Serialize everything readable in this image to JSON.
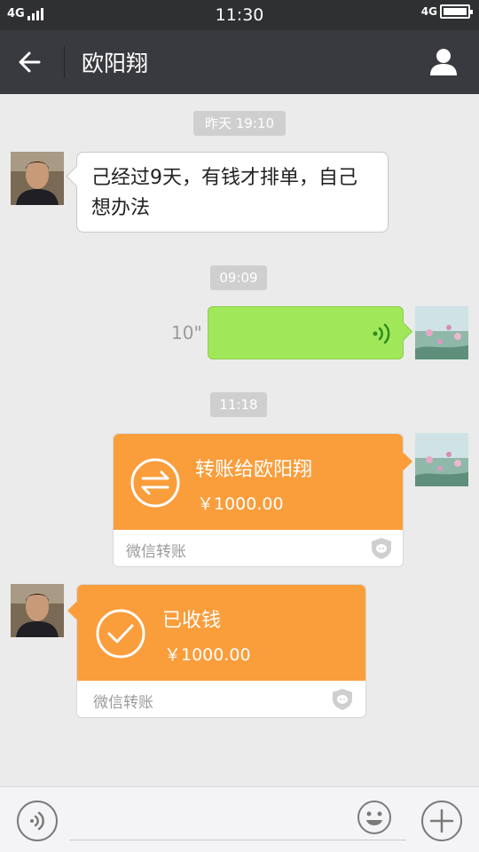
{
  "status_bar": {
    "network_left": "4G",
    "time": "11:30",
    "network_right": "4G"
  },
  "nav": {
    "title": "欧阳翔",
    "back_icon": "arrow-left-icon",
    "profile_icon": "person-icon"
  },
  "messages": {
    "ts1": "昨天 19:10",
    "msg1_text": "己经过9天，有钱才排单，自己想办法",
    "ts2": "09:09",
    "voice_duration": "10\"",
    "ts3": "11:18",
    "transfer_out": {
      "title": "转账给欧阳翔",
      "amount": "￥1000.00",
      "footer": "微信转账"
    },
    "transfer_received": {
      "title": "已收钱",
      "amount": "￥1000.00",
      "footer": "微信转账"
    }
  },
  "colors": {
    "nav_bg": "#393a3f",
    "voice_bubble": "#a0e75a",
    "transfer_orange": "#fa9d3b",
    "chat_bg": "#ebebeb"
  },
  "input_bar": {
    "voice_icon": "voice-input-icon",
    "emoji_icon": "emoji-icon",
    "plus_icon": "plus-icon"
  }
}
